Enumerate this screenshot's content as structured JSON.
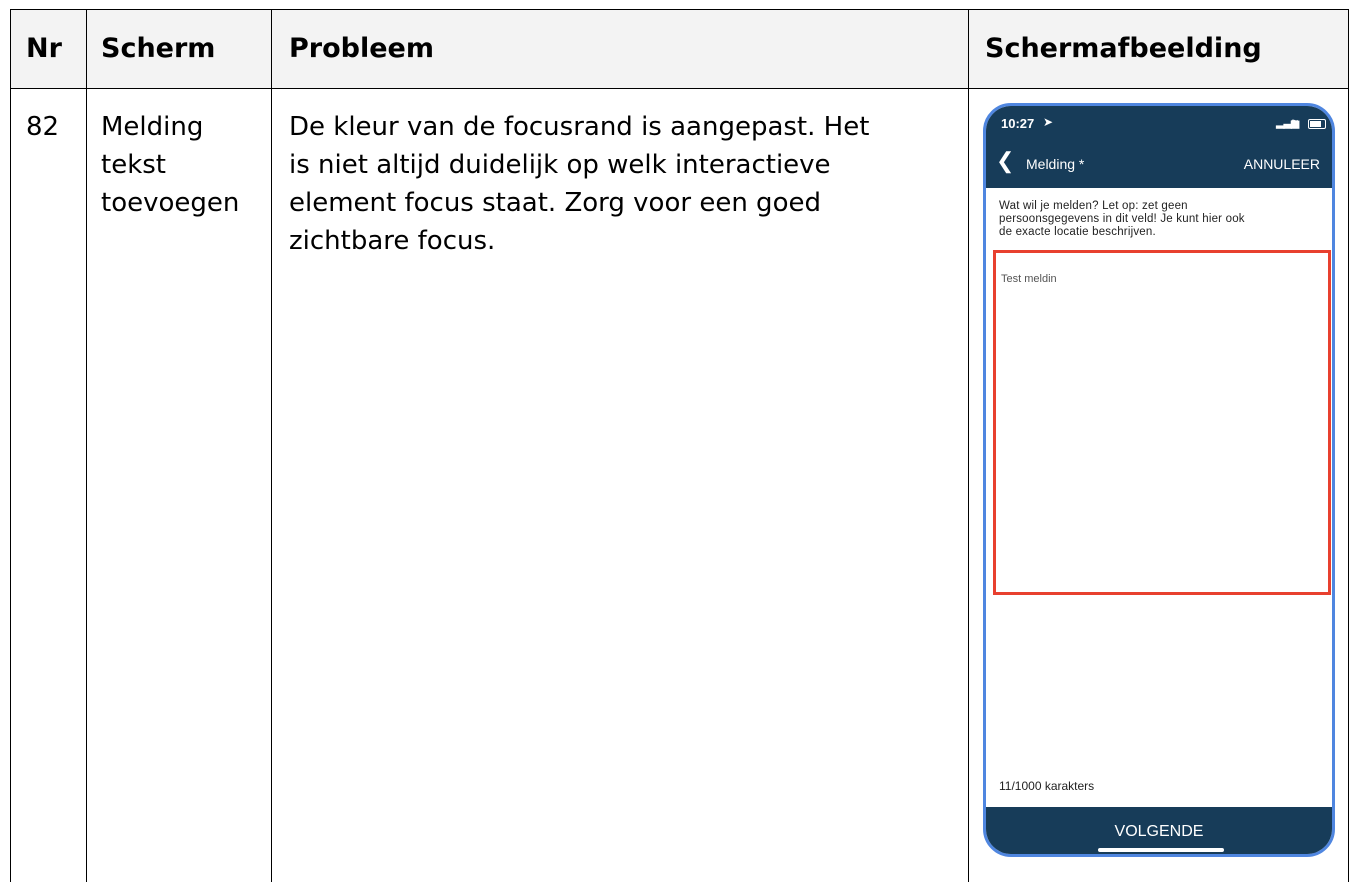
{
  "table": {
    "headers": {
      "nr": "Nr",
      "scherm": "Scherm",
      "probleem": "Probleem",
      "schermafbeelding": "Schermafbeelding"
    },
    "row": {
      "nr": "82",
      "scherm_lines": [
        "Melding",
        "tekst",
        "toevoegen"
      ],
      "probleem_lines": [
        "De kleur van de focusrand is aangepast. Het",
        "is niet altijd duidelijk op welk interactieve",
        "element focus staat. Zorg voor een goed",
        "zichtbare focus."
      ]
    }
  },
  "phone": {
    "status_time": "10:27",
    "nav_title": "Melding *",
    "cancel_label": "ANNULEER",
    "prompt_lines": [
      "Wat wil je melden? Let op: zet geen",
      "persoonsgegevens in dit veld! Je kunt hier ook",
      "de exacte locatie beschrijven."
    ],
    "textarea_value": "Test meldin",
    "counter": "11/1000 karakters",
    "next_label": "VOLGENDE"
  },
  "colors": {
    "header_bg": "#f3f3f3",
    "phone_bar": "#173c59",
    "focus_highlight": "#e8402f",
    "phone_frame": "#4f86e0"
  }
}
